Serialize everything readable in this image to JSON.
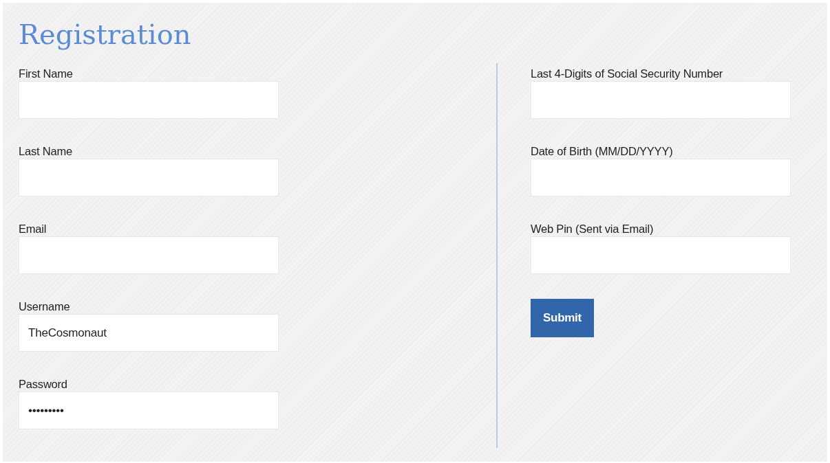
{
  "title": "Registration",
  "left_fields": [
    {
      "label": "First Name"
    },
    {
      "label": "Last Name"
    },
    {
      "label": "Email"
    },
    {
      "label": "Username",
      "value": "TheCosmonaut"
    },
    {
      "label": "Password",
      "value": "•••••••••"
    }
  ],
  "right_fields": [
    {
      "label": "Last 4-Digits of Social Security Number"
    },
    {
      "label": "Date of Birth (MM/DD/YYYY)"
    },
    {
      "label": "Web Pin (Sent via Email)"
    }
  ],
  "submit_button": "Submit"
}
